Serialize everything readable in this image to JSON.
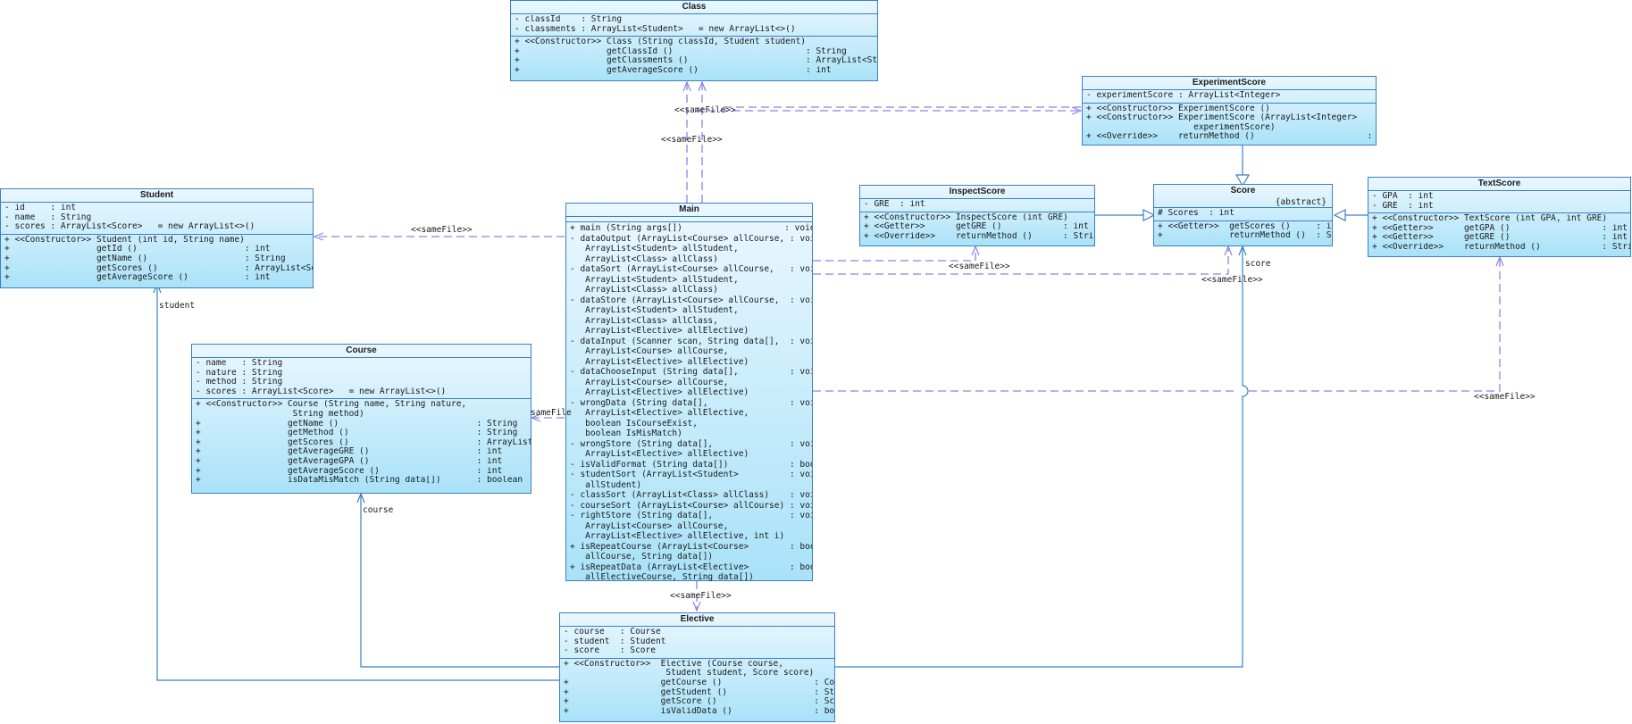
{
  "classes": {
    "class_box": {
      "name": "Class",
      "attributes": [
        "- classId    : String",
        "- classments : ArrayList<Student>   = new ArrayList<>()"
      ],
      "operations": [
        "+ <<Constructor>> Class (String classId, Student student)",
        "+                 getClassId ()                          : String",
        "+                 getClassments ()                       : ArrayList<Student>",
        "+                 getAverageScore ()                     : int"
      ]
    },
    "experiment": {
      "name": "ExperimentScore",
      "attributes": [
        "- experimentScore : ArrayList<Integer>"
      ],
      "operations": [
        "+ <<Constructor>> ExperimentScore ()",
        "+ <<Constructor>> ExperimentScore (ArrayList<Integer>",
        "                     experimentScore)",
        "+ <<Override>>    returnMethod ()                      : String"
      ]
    },
    "inspect": {
      "name": "InspectScore",
      "attributes": [
        "- GRE  : int"
      ],
      "operations": [
        "+ <<Constructor>> InspectScore (int GRE)",
        "+ <<Getter>>      getGRE ()            : int",
        "+ <<Override>>    returnMethod ()      : String"
      ]
    },
    "score": {
      "name": "Score",
      "stereotype": "{abstract}",
      "attributes": [
        "# Scores  : int"
      ],
      "operations": [
        "+ <<Getter>>  getScores ()     : int",
        "+             returnMethod ()  : String"
      ]
    },
    "text": {
      "name": "TextScore",
      "attributes": [
        "- GPA  : int",
        "- GRE  : int"
      ],
      "operations": [
        "+ <<Constructor>> TextScore (int GPA, int GRE)",
        "+ <<Getter>>      getGPA ()                  : int",
        "+ <<Getter>>      getGRE ()                  : int",
        "+ <<Override>>    returnMethod ()            : String"
      ]
    },
    "student": {
      "name": "Student",
      "attributes": [
        "- id     : int",
        "- name   : String",
        "- scores : ArrayList<Score>   = new ArrayList<>()"
      ],
      "operations": [
        "+ <<Constructor>> Student (int id, String name)",
        "+                 getId ()                     : int",
        "+                 getName ()                   : String",
        "+                 getScores ()                 : ArrayList<Score>",
        "+                 getAverageScore ()           : int"
      ]
    },
    "course": {
      "name": "Course",
      "attributes": [
        "- name   : String",
        "- nature : String",
        "- method : String",
        "- scores : ArrayList<Score>   = new ArrayList<>()"
      ],
      "operations": [
        "+ <<Constructor>> Course (String name, String nature,",
        "                   String method)",
        "+                 getName ()                           : String",
        "+                 getMethod ()                         : String",
        "+                 getScores ()                         : ArrayList<Score>",
        "+                 getAverageGRE ()                     : int",
        "+                 getAverageGPA ()                     : int",
        "+                 getAverageScore ()                   : int",
        "+                 isDataMisMatch (String data[])       : boolean"
      ]
    },
    "main": {
      "name": "Main",
      "attributes": [],
      "operations": [
        "+ main (String args[])                    : void",
        "- dataOutput (ArrayList<Course> allCourse, : void",
        "   ArrayList<Student> allStudent,",
        "   ArrayList<Class> allClass)",
        "- dataSort (ArrayList<Course> allCourse,   : void",
        "   ArrayList<Student> allStudent,",
        "   ArrayList<Class> allClass)",
        "- dataStore (ArrayList<Course> allCourse,  : void",
        "   ArrayList<Student> allStudent,",
        "   ArrayList<Class> allClass,",
        "   ArrayList<Elective> allElective)",
        "- dataInput (Scanner scan, String data[],  : void",
        "   ArrayList<Course> allCourse,",
        "   ArrayList<Elective> allElective)",
        "- dataChooseInput (String data[],          : void",
        "   ArrayList<Course> allCourse,",
        "   ArrayList<Elective> allElective)",
        "- wrongData (String data[],                : void",
        "   ArrayList<Elective> allElective,",
        "   boolean IsCourseExist,",
        "   boolean IsMisMatch)",
        "- wrongStore (String data[],               : void",
        "   ArrayList<Elective> allElective)",
        "- isValidFormat (String data[])            : boolean",
        "- studentSort (ArrayList<Student>          : void",
        "   allStudent)",
        "- classSort (ArrayList<Class> allClass)    : void",
        "- courseSort (ArrayList<Course> allCourse) : void",
        "- rightStore (String data[],               : void",
        "   ArrayList<Course> allCourse,",
        "   ArrayList<Elective> allElective, int i)",
        "+ isRepeatCourse (ArrayList<Course>        : boolean",
        "   allCourse, String data[])",
        "+ isRepeatData (ArrayList<Elective>        : boolean",
        "   allElectiveCourse, String data[])"
      ]
    },
    "elective": {
      "name": "Elective",
      "attributes": [
        "- course   : Course",
        "- student  : Student",
        "- score    : Score"
      ],
      "operations": [
        "+ <<Constructor>>  Elective (Course course,",
        "                    Student student, Score score)",
        "+                  getCourse ()                  : Course",
        "+                  getStudent ()                 : Student",
        "+                  getScore ()                   : Score",
        "+                  isValidData ()                : boolean"
      ]
    }
  },
  "labels": {
    "samefile_class_exp": "<<sameFile>>",
    "samefile_main_class": "<<sameFile>>",
    "samefile_main_student": "<<sameFile>>",
    "samefile_main_inspect": "<<sameFile>>",
    "samefile_main_score": "<<sameFile>>",
    "samefile_main_text": "<<sameFile>>",
    "samefile_main_course": "sameFile",
    "samefile_main_elective": "<<sameFile>>",
    "role_student": "student",
    "role_course": "course",
    "role_score": "score"
  },
  "colors": {
    "box_border": "#3b7fc4",
    "box_top": "#eaf7ff",
    "box_bottom": "#a9e2f8",
    "dependency": "#8a84e8",
    "association": "#3b7fc4"
  }
}
